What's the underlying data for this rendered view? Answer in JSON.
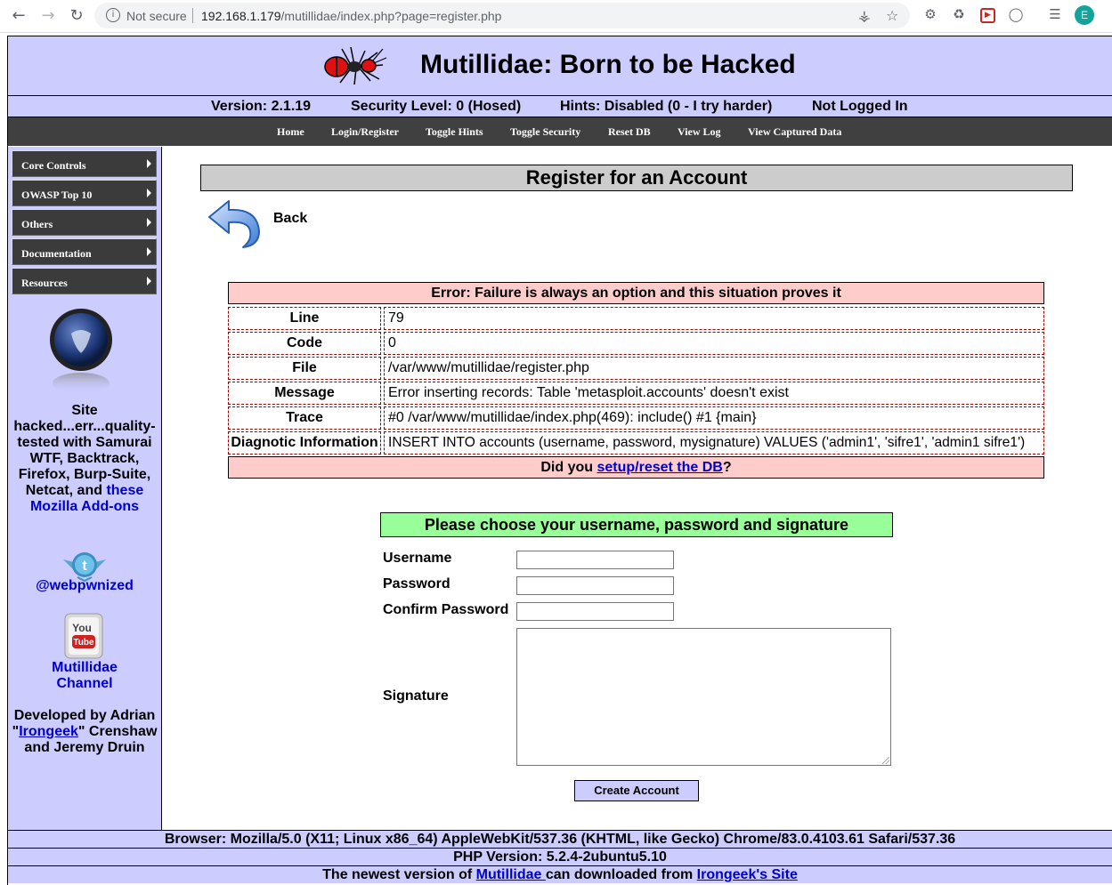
{
  "browser": {
    "security_label": "Not secure",
    "url_host": "192.168.1.179",
    "url_path": "/mutillidae/index.php?page=register.php",
    "profile_initial": "E"
  },
  "header": {
    "title": "Mutillidae: Born to be Hacked",
    "version": "Version: 2.1.19",
    "security_level": "Security Level: 0 (Hosed)",
    "hints": "Hints: Disabled (0 - I try harder)",
    "login_status": "Not Logged In"
  },
  "menu": {
    "items": [
      "Home",
      "Login/Register",
      "Toggle Hints",
      "Toggle Security",
      "Reset DB",
      "View Log",
      "View Captured Data"
    ]
  },
  "sidebar": {
    "items": [
      "Core Controls",
      "OWASP Top 10",
      "Others",
      "Documentation",
      "Resources"
    ],
    "site_text_1": "Site",
    "site_text_2": "hacked...err...quality-",
    "site_text_3": "tested with Samurai",
    "site_text_4": "WTF, Backtrack,",
    "site_text_5": "Firefox, Burp-Suite,",
    "site_text_6": "Netcat, and",
    "these_link": "these",
    "addons_link": "Mozilla Add-ons",
    "twitter_handle": "@webpwnized",
    "channel_line1": "Mutillidae",
    "channel_line2": "Channel",
    "dev_line1": "Developed by Adrian",
    "dev_quote_open": "\"",
    "irongeek_link": "Irongeek",
    "dev_line2_rest": "\" Crenshaw",
    "dev_line3": "and Jeremy Druin"
  },
  "main": {
    "page_title": "Register for an Account",
    "back_label": "Back",
    "error": {
      "header": "Error: Failure is always an option and this situation proves it",
      "rows": [
        {
          "key": "Line",
          "value": "79"
        },
        {
          "key": "Code",
          "value": "0"
        },
        {
          "key": "File",
          "value": "/var/www/mutillidae/register.php"
        },
        {
          "key": "Message",
          "value": "Error inserting records: Table 'metasploit.accounts' doesn't exist"
        },
        {
          "key": "Trace",
          "value": "#0 /var/www/mutillidae/index.php(469): include() #1 {main}"
        },
        {
          "key": "Diagnotic Information",
          "value": "INSERT INTO accounts (username, password, mysignature) VALUES ('admin1', 'sifre1', 'admin1 sifre1')"
        }
      ],
      "footer_prefix": "Did you ",
      "footer_link": "setup/reset the DB",
      "footer_suffix": "?"
    },
    "form": {
      "title": "Please choose your username, password and signature",
      "username_label": "Username",
      "password_label": "Password",
      "confirm_label": "Confirm Password",
      "signature_label": "Signature",
      "username_value": "",
      "password_value": "",
      "confirm_value": "",
      "signature_value": "",
      "submit_label": "Create Account"
    }
  },
  "footer": {
    "browser_line": "Browser: Mozilla/5.0 (X11; Linux x86_64) AppleWebKit/537.36 (KHTML, like Gecko) Chrome/83.0.4103.61 Safari/537.36",
    "php_line": "PHP Version: 5.2.4-2ubuntu5.10",
    "newest_prefix": "The newest version of ",
    "newest_link1": "Mutillidae ",
    "newest_middle": " can downloaded from ",
    "newest_link2": "Irongeek's Site"
  },
  "colors": {
    "header_bg": "#ccccff",
    "menu_bg": "#404040",
    "error_bg": "#ffcccc",
    "form_title_bg": "#99ff99",
    "link": "#0000cc"
  }
}
